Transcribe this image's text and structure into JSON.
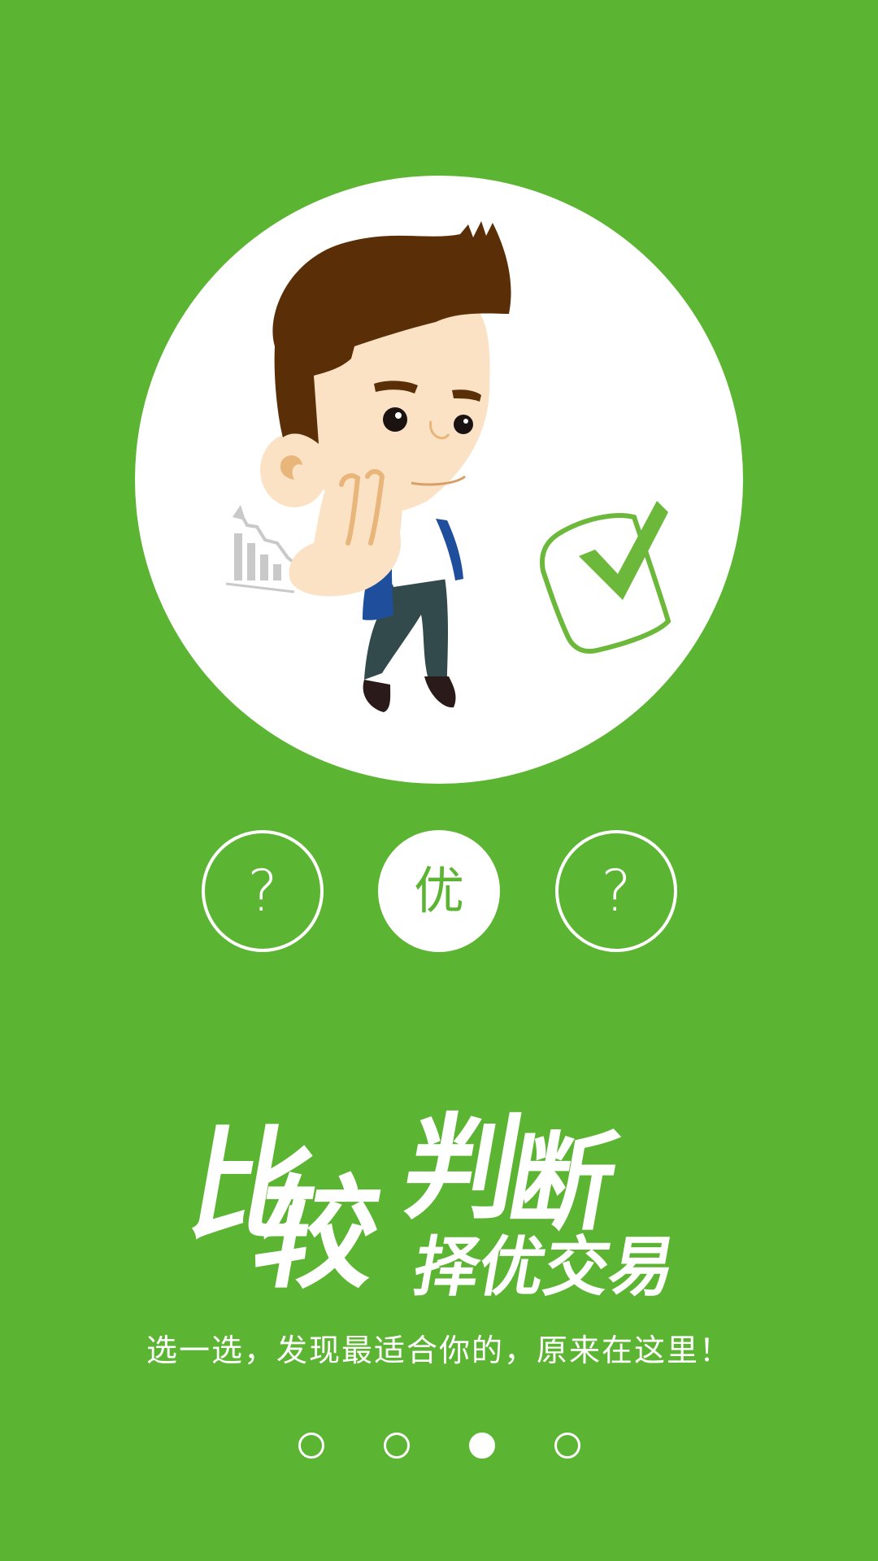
{
  "theme": {
    "background": "#5cb532",
    "accent": "#ffffff",
    "check_green": "#6bb83a"
  },
  "illustration": {
    "figure": "cartoon-man-pondering",
    "side_icons": [
      "falling-chart-icon",
      "checkmark-badge-icon"
    ]
  },
  "choices": [
    {
      "label": "?",
      "selected": false
    },
    {
      "label": "优",
      "selected": true
    },
    {
      "label": "?",
      "selected": false
    }
  ],
  "headline": {
    "line1": [
      "比",
      "较",
      "判",
      "断"
    ],
    "line2": "择优交易"
  },
  "tagline": "选一选，发现最适合你的，原来在这里！",
  "pager": {
    "count": 4,
    "active_index": 2
  }
}
